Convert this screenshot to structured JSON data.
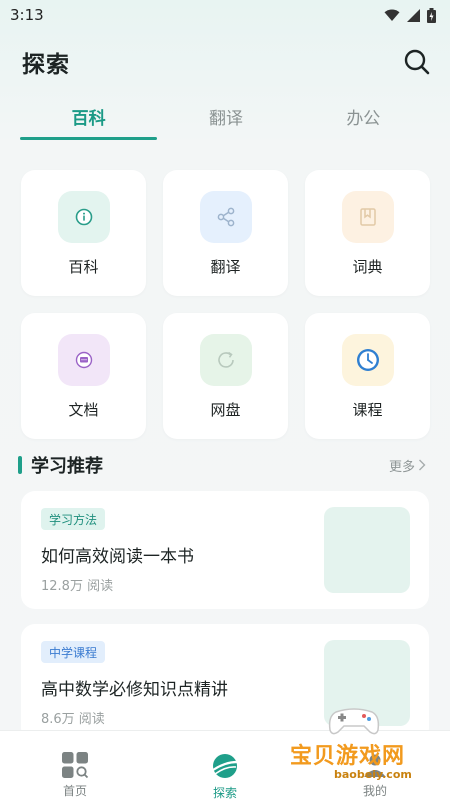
{
  "status": {
    "time": "3:13"
  },
  "header": {
    "title": "探索"
  },
  "tabs": [
    {
      "label": "百科",
      "active": true
    },
    {
      "label": "翻译",
      "active": false
    },
    {
      "label": "办公",
      "active": false
    }
  ],
  "grid": [
    {
      "label": "百科",
      "icon": "info-icon",
      "bg": "#e3f4ef",
      "color": "#2a9d8a"
    },
    {
      "label": "翻译",
      "icon": "share-icon",
      "bg": "#e5f0fd",
      "color": "#9db3cc"
    },
    {
      "label": "词典",
      "icon": "bookmark-icon",
      "bg": "#fdf1e2",
      "color": "#e2c9a6"
    },
    {
      "label": "文档",
      "icon": "chat-icon",
      "bg": "#f2e6f8",
      "color": "#9b63c7"
    },
    {
      "label": "网盘",
      "icon": "refresh-icon",
      "bg": "#e6f4e8",
      "color": "#b8c9bd"
    },
    {
      "label": "课程",
      "icon": "clock-icon",
      "bg": "#fdf4dd",
      "color": "#2f7fd1"
    }
  ],
  "section": {
    "title": "学习推荐",
    "more": "更多"
  },
  "articles": [
    {
      "tag": "学习方法",
      "title": "如何高效阅读一本书",
      "meta": "12.8万 阅读"
    },
    {
      "tag": "中学课程",
      "title": "高中数学必修知识点精讲",
      "meta": "8.6万 阅读"
    }
  ],
  "nav": [
    {
      "label": "首页",
      "icon": "grid-search-icon",
      "active": false
    },
    {
      "label": "探索",
      "icon": "planet-icon",
      "active": true
    },
    {
      "label": "我的",
      "icon": "user-icon",
      "active": false
    }
  ],
  "watermark": {
    "text": "宝贝游戏网",
    "url": "baobeiy.com"
  },
  "colors": {
    "accent": "#1f9f8a",
    "background": "#f4f6f7"
  }
}
